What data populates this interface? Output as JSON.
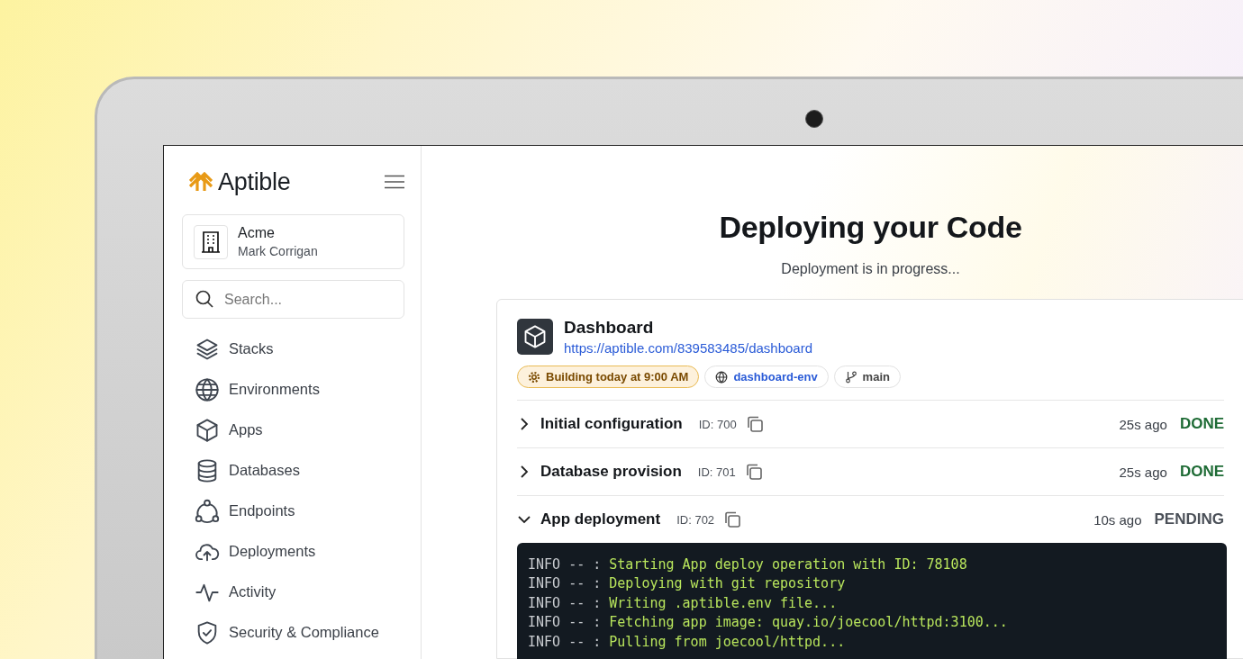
{
  "sidebar": {
    "logo": "Aptible",
    "account": {
      "name": "Acme",
      "user": "Mark Corrigan"
    },
    "search": {
      "placeholder": "Search..."
    },
    "items": [
      {
        "label": "Stacks"
      },
      {
        "label": "Environments"
      },
      {
        "label": "Apps"
      },
      {
        "label": "Databases"
      },
      {
        "label": "Endpoints"
      },
      {
        "label": "Deployments"
      },
      {
        "label": "Activity"
      },
      {
        "label": "Security & Compliance"
      }
    ]
  },
  "main": {
    "title": "Deploying your Code",
    "subtitle": "Deployment is in progress...",
    "app": {
      "name": "Dashboard",
      "url": "https://aptible.com/839583485/dashboard",
      "tags": [
        {
          "kind": "status",
          "label": "Building today at 9:00 AM"
        },
        {
          "kind": "environment",
          "label": "dashboard-env"
        },
        {
          "kind": "branch",
          "label": "main"
        }
      ]
    },
    "steps": [
      {
        "name": "Initial configuration",
        "id": "ID: 700",
        "time": "25s ago",
        "status": "DONE",
        "kind": "done",
        "expanded": false
      },
      {
        "name": "Database provision",
        "id": "ID: 701",
        "time": "25s ago",
        "status": "DONE",
        "kind": "done",
        "expanded": false
      },
      {
        "name": "App deployment",
        "id": "ID: 702",
        "time": "10s ago",
        "status": "PENDING",
        "kind": "pending",
        "expanded": true
      }
    ],
    "log": [
      {
        "level": "INFO -- :",
        "message": "Starting App deploy operation with ID: 78108"
      },
      {
        "level": "INFO -- :",
        "message": "Deploying with git repository"
      },
      {
        "level": "INFO -- :",
        "message": "Writing .aptible.env file..."
      },
      {
        "level": "INFO -- :",
        "message": "Fetching app image: quay.io/joecool/httpd:3100..."
      },
      {
        "level": "INFO -- :",
        "message": "Pulling from joecool/httpd..."
      }
    ]
  }
}
